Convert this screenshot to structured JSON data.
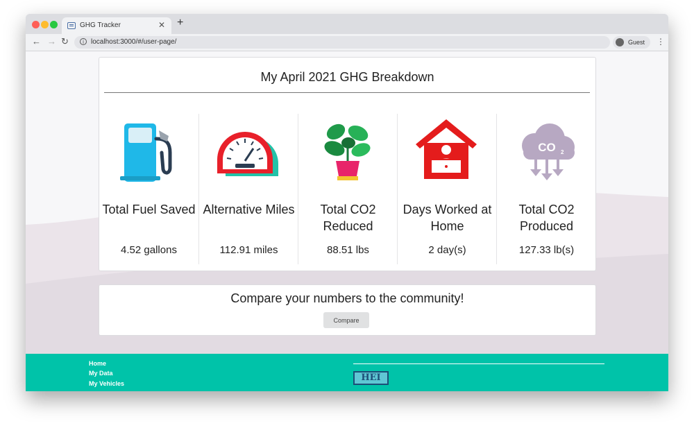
{
  "browser": {
    "tab_title": "GHG Tracker",
    "url": "localhost:3000/#/user-page/",
    "profile_label": "Guest"
  },
  "breakdown": {
    "title": "My April 2021 GHG Breakdown",
    "stats": [
      {
        "icon": "fuel-pump-icon",
        "label": "Total Fuel Saved",
        "value": "4.52 gallons"
      },
      {
        "icon": "speedometer-icon",
        "label": "Alternative Miles",
        "value": "112.91 miles"
      },
      {
        "icon": "plant-icon",
        "label": "Total CO2 Reduced",
        "value": "88.51 lbs"
      },
      {
        "icon": "work-from-home-icon",
        "label": "Days Worked at Home",
        "value": "2 day(s)"
      },
      {
        "icon": "co2-cloud-icon",
        "label": "Total CO2 Produced",
        "value": "127.33 lb(s)"
      }
    ]
  },
  "compare": {
    "title": "Compare your numbers to the community!",
    "button_label": "Compare"
  },
  "footer": {
    "links": [
      "Home",
      "My Data",
      "My Vehicles"
    ],
    "logo_text": "HEI"
  },
  "colors": {
    "footer": "#00c3a9",
    "fuel": "#1fb8e8",
    "speedometer_red": "#e8202a",
    "house_red": "#e41c1c",
    "cloud": "#b7a8c2"
  }
}
